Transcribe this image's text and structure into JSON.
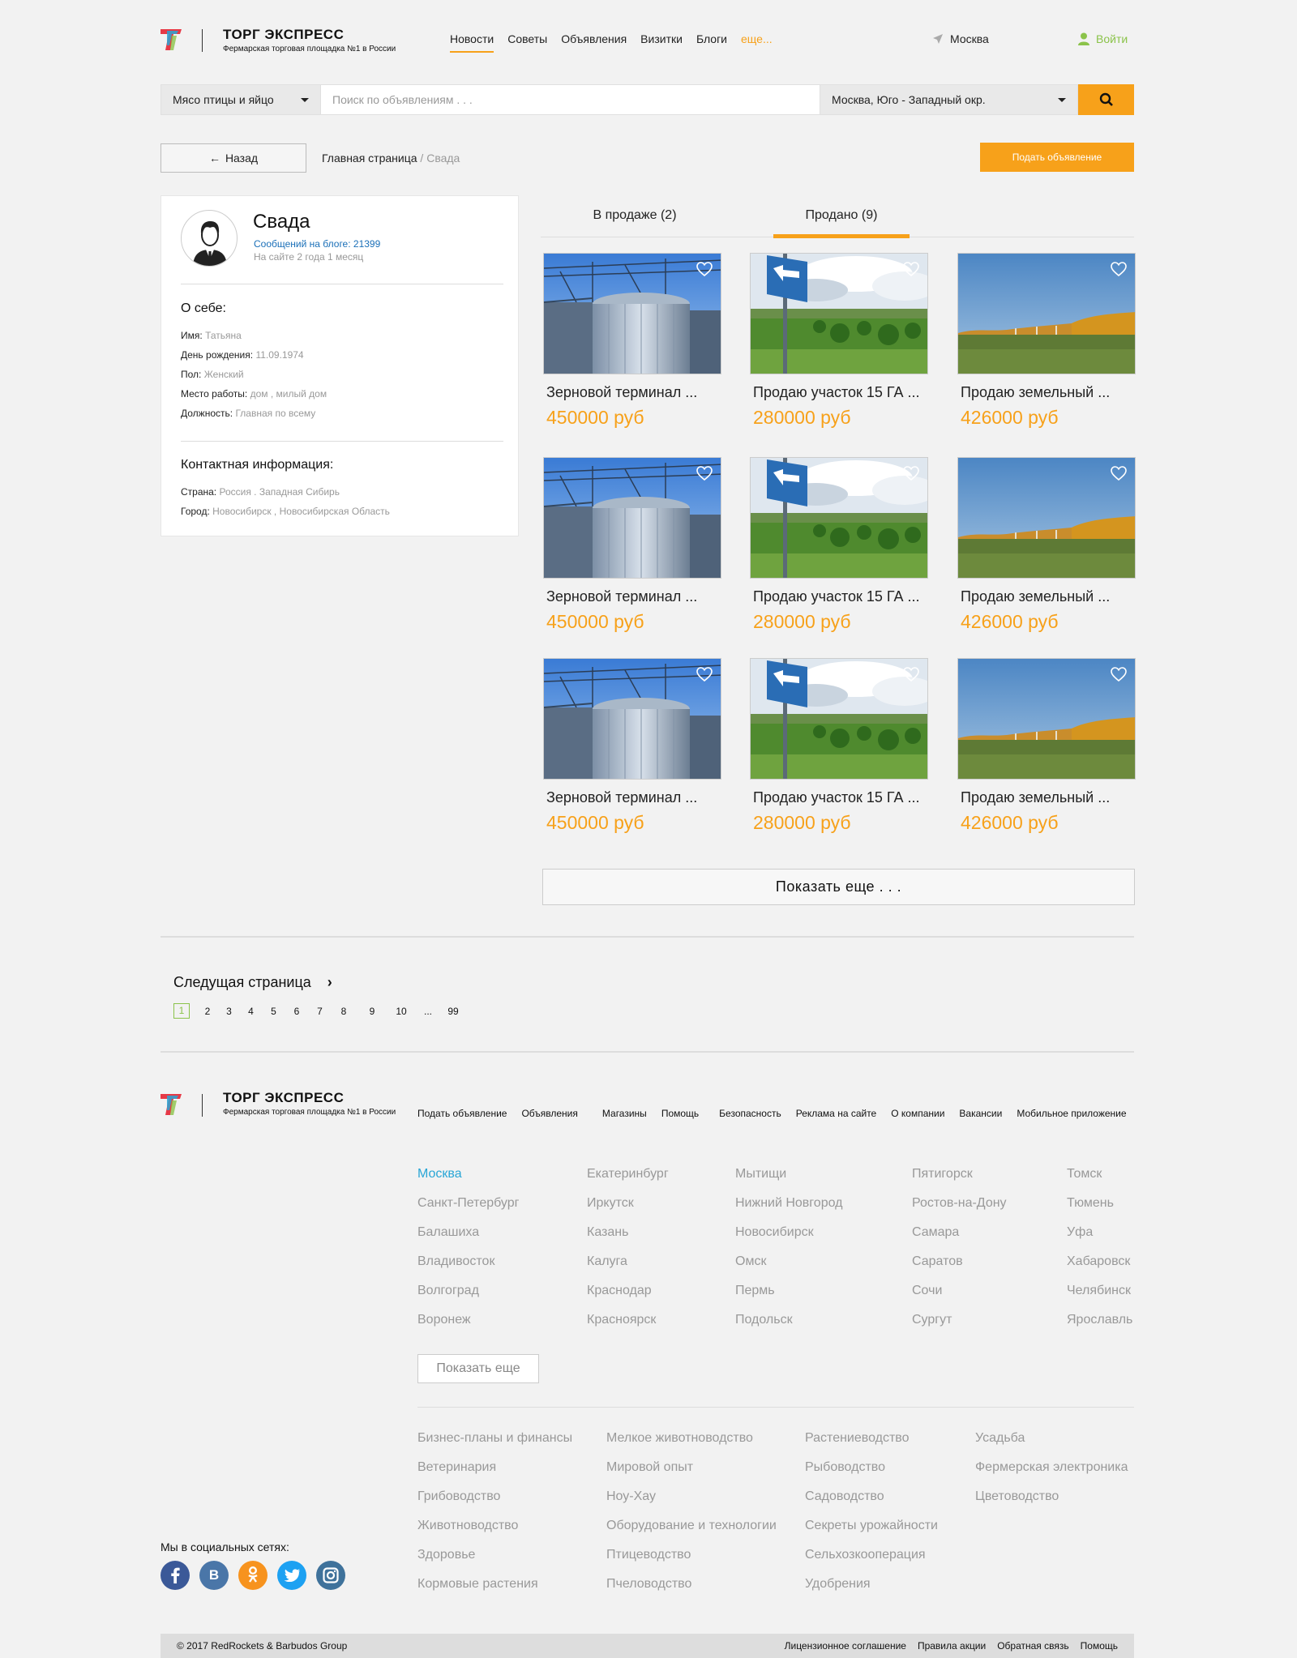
{
  "header": {
    "brand": "ТОРГ ЭКСПРЕСС",
    "tagline": "Фермарская торговая площадка №1 в России",
    "nav": [
      "Новости",
      "Советы",
      "Объявления",
      "Визитки",
      "Блоги"
    ],
    "nav_more": "еще...",
    "city": "Москва",
    "login": "Войти"
  },
  "search": {
    "category": "Мясо птицы и яйцо",
    "placeholder": "Поиск по объявлениям . . .",
    "region": "Москва, Юго - Западный окр."
  },
  "toolbar": {
    "back": "Назад",
    "crumb_home": "Главная страница",
    "crumb_sep": "/",
    "crumb_current": "Свада",
    "post_ad": "Подать объявление"
  },
  "profile": {
    "name": "Свада",
    "posts": "Сообщений на блоге: 21399",
    "since": "На сайте 2 года 1 месяц",
    "about_title": "О себе:",
    "about": [
      {
        "label": "Имя:",
        "value": "Татьяна"
      },
      {
        "label": "День рождения:",
        "value": "11.09.1974"
      },
      {
        "label": "Пол:",
        "value": "Женский"
      },
      {
        "label": "Место работы:",
        "value": "дом , милый дом"
      },
      {
        "label": "Должность:",
        "value": "Главная по всему"
      }
    ],
    "contact_title": "Контактная информация:",
    "contact": [
      {
        "label": "Страна:",
        "value": "Россия . Западная Сибирь"
      },
      {
        "label": "Город:",
        "value": "Новосибирск , Новосибирская Область"
      }
    ]
  },
  "tabs": {
    "for_sale": "В продаже (2)",
    "sold": "Продано (9)",
    "active": "sold"
  },
  "listings": [
    {
      "title": "Зерновой терминал ...",
      "price": "450000 руб",
      "image": "grain-silo"
    },
    {
      "title": "Продаю участок 15 ГА ...",
      "price": "280000 руб",
      "image": "land-sign"
    },
    {
      "title": "Продаю земельный ...",
      "price": "426000 руб",
      "image": "autumn-field"
    },
    {
      "title": "Зерновой терминал ...",
      "price": "450000 руб",
      "image": "grain-silo"
    },
    {
      "title": "Продаю участок 15 ГА ...",
      "price": "280000 руб",
      "image": "land-sign"
    },
    {
      "title": "Продаю земельный ...",
      "price": "426000 руб",
      "image": "autumn-field"
    },
    {
      "title": "Зерновой терминал ...",
      "price": "450000 руб",
      "image": "grain-silo"
    },
    {
      "title": "Продаю участок 15 ГА ...",
      "price": "280000 руб",
      "image": "land-sign"
    },
    {
      "title": "Продаю земельный ...",
      "price": "426000 руб",
      "image": "autumn-field"
    }
  ],
  "show_more": "Показать еще . . .",
  "pagination": {
    "next": "Следущая страница",
    "pages": [
      "1",
      "2",
      "3",
      "4",
      "5",
      "6",
      "7",
      "8",
      "9",
      "10",
      "...",
      "99"
    ],
    "current": "1"
  },
  "footer": {
    "brand": "ТОРГ ЭКСПРЕСС",
    "tagline": "Фермарская торговая площадка №1 в России",
    "links": [
      "Подать объявление",
      "Объявления",
      "Магазины",
      "Помощь",
      "Безопасность",
      "Реклама на сайте",
      "О компании",
      "Вакансии",
      "Мобильное приложение"
    ],
    "cities": [
      [
        "Москва",
        "Санкт-Петербург",
        "Балашиха",
        "Владивосток",
        "Волгоград",
        "Воронеж"
      ],
      [
        "Екатеринбург",
        "Иркутск",
        "Казань",
        "Калуга",
        "Краснодар",
        "Красноярск"
      ],
      [
        "Мытищи",
        "Нижний Новгород",
        "Новосибирск",
        "Омск",
        "Пермь",
        "Подольск"
      ],
      [
        "Пятигорск",
        "Ростов-на-Дону",
        "Самара",
        "Саратов",
        "Сочи",
        "Сургут"
      ],
      [
        "Томск",
        "Тюмень",
        "Уфа",
        "Хабаровск",
        "Челябинск",
        "Ярославль"
      ]
    ],
    "show_more": "Показать еще",
    "categories": [
      [
        "Бизнес-планы и финансы",
        "Ветеринария",
        "Грибоводство",
        "Животноводство",
        "Здоровье",
        "Кормовые растения"
      ],
      [
        "Мелкое животноводство",
        "Мировой опыт",
        "Ноу-Хау",
        "Оборудование и технологии",
        "Птицеводство",
        "Пчеловодство"
      ],
      [
        "Растениеводство",
        "Рыбоводство",
        "Садоводство",
        "Секреты урожайности",
        "Сельхозкооперация",
        "Удобрения"
      ],
      [
        "Усадьба",
        "Фермерская электроника",
        "Цветоводство"
      ]
    ],
    "social_title": "Мы в социальных сетях:",
    "socials": [
      {
        "name": "facebook",
        "glyph": "f",
        "color": "#3b5998"
      },
      {
        "name": "vk",
        "glyph": "B",
        "color": "#4a76a8"
      },
      {
        "name": "odnoklassniki",
        "glyph": "ok",
        "color": "#f7931e"
      },
      {
        "name": "twitter",
        "glyph": "t",
        "color": "#1da1f2"
      },
      {
        "name": "instagram",
        "glyph": "ig",
        "color": "#3f729b"
      }
    ],
    "copyright": "© 2017 RedRockets & Barbudos Group",
    "bottom_links": [
      "Лицензионное соглашение",
      "Правила акции",
      "Обратная связь",
      "Помощь"
    ]
  },
  "colors": {
    "accent": "#f7a11a",
    "green": "#8bc34a",
    "link_blue": "#1a6fb8",
    "city_blue": "#29a6d6"
  }
}
